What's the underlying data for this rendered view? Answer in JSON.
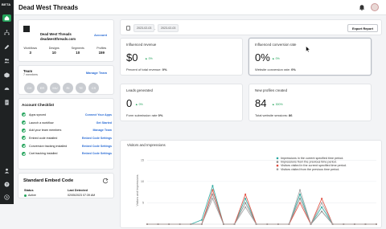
{
  "app": {
    "badge": "BETA",
    "org_title": "Dead West Threads"
  },
  "rail_icons": [
    "home-icon",
    "sitemap-icon",
    "pen-icon",
    "users-icon",
    "box-icon",
    "gauge-icon",
    "document-icon",
    "team-icon",
    "help-icon",
    "logout-icon"
  ],
  "account": {
    "name": "Dead West Threads",
    "url": "deadwestthreads.com",
    "link_label": "Account",
    "stats": [
      {
        "label": "Workflows",
        "value": "3"
      },
      {
        "label": "Designs",
        "value": "10"
      },
      {
        "label": "Segments",
        "value": "10"
      },
      {
        "label": "Profiles",
        "value": "159"
      }
    ]
  },
  "team": {
    "title": "Team",
    "count": "7 members",
    "link_label": "Manage Team",
    "avatars": [
      "CH",
      "ER",
      "MU",
      "RI",
      "TE",
      "CS"
    ]
  },
  "checklist": {
    "title": "Account Checklist",
    "items": [
      {
        "label": "Apps synced",
        "link": "Connect Your Apps"
      },
      {
        "label": "Launch a workflow",
        "link": "Get Started"
      },
      {
        "label": "Add your team members",
        "link": "Manage Team"
      },
      {
        "label": "Embed code installed",
        "link": "Embed Code Settings"
      },
      {
        "label": "Conversion tracking installed",
        "link": "Embed Code Settings"
      },
      {
        "label": "Cart tracking installed",
        "link": "Embed Code Settings"
      }
    ]
  },
  "embed": {
    "title": "Standard Embed Code",
    "status_label": "Status",
    "status_value": "Active",
    "detected_label": "Last Detected",
    "detected_value": "02/05/2023 07:39 AM"
  },
  "filter": {
    "start_date": "2023-02-03",
    "end_date": "2023-02-03",
    "separator": "-",
    "export_label": "Export Report"
  },
  "kpis": [
    {
      "title": "Influenced revenue",
      "value": "$0",
      "delta": "0%",
      "foot_label": "Percent of total revenue:",
      "foot_value": "0%"
    },
    {
      "title": "Influenced conversion rate",
      "value": "0%",
      "delta": "0%",
      "foot_label": "Website conversion rate:",
      "foot_value": "0%"
    },
    {
      "title": "Leads generated",
      "value": "0",
      "delta": "0%",
      "foot_label": "Form submission rate",
      "foot_value": "0%"
    },
    {
      "title": "New profiles created",
      "value": "84",
      "delta": "300%",
      "foot_label": "Total website sessions:",
      "foot_value": "86"
    }
  ],
  "chart_data": {
    "type": "line",
    "title": "Visitors and Impressions",
    "ylabel": "Visitors and Impressions",
    "y_ticks": [
      "15",
      "10",
      "5"
    ],
    "ylim": [
      0,
      16
    ],
    "legend_position": "top-right",
    "series": [
      {
        "name": "Impressions in the current specified time period.",
        "color": "#2ba8a0",
        "values": [
          0,
          0,
          0,
          0,
          0,
          1,
          9,
          0,
          0,
          6,
          0,
          0,
          0,
          0,
          7,
          0,
          4,
          0,
          0,
          0,
          0,
          0
        ]
      },
      {
        "name": "Impressions from the previous time period.",
        "color": "#8a8a8a",
        "values": [
          0,
          0,
          0,
          0,
          0,
          0,
          7,
          0,
          0,
          5,
          0,
          0,
          0,
          0,
          6,
          0,
          3,
          0,
          0,
          0,
          0,
          0
        ]
      },
      {
        "name": "Visitors visited in the current specified time period.",
        "color": "#e04a3c",
        "values": [
          0,
          0,
          0,
          0,
          0,
          0,
          8,
          0,
          0,
          7,
          0,
          0,
          0,
          0,
          5,
          0,
          6,
          0,
          0,
          0,
          0,
          0
        ]
      },
      {
        "name": "Visitors visited from the previous time period.",
        "color": "#a0a0a0",
        "values": [
          0,
          0,
          0,
          0,
          0,
          0,
          6,
          0,
          0,
          4,
          0,
          0,
          0,
          0,
          8,
          0,
          5,
          0,
          0,
          0,
          0,
          0
        ]
      }
    ]
  }
}
